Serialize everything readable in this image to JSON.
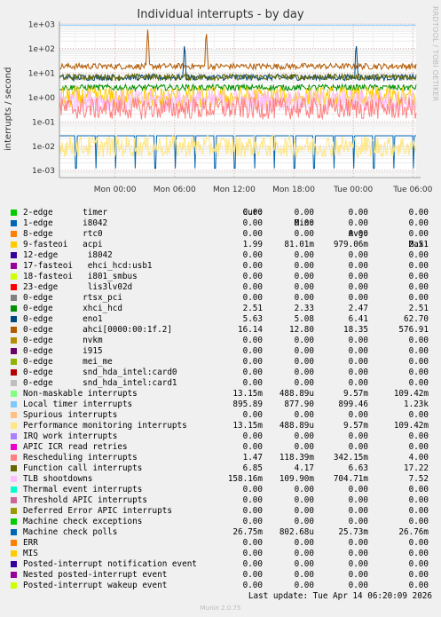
{
  "title": "Individual interrupts - by day",
  "side_label": "RRDTOOL / TOBI OETIKER",
  "ylabel": "interrupts / second",
  "headers": {
    "cur": "Cur:",
    "min": "Min:",
    "avg": "Avg:",
    "max": "Max:"
  },
  "legend": [
    {
      "name": "2-edge      timer",
      "color": "#00cc00",
      "cur": "0.00",
      "min": "0.00",
      "avg": "0.00",
      "max": "0.00"
    },
    {
      "name": "1-edge      i8042",
      "color": "#0066b3",
      "cur": "0.00",
      "min": "0.00",
      "avg": "0.00",
      "max": "0.00"
    },
    {
      "name": "8-edge      rtc0",
      "color": "#ff8000",
      "cur": "0.00",
      "min": "0.00",
      "avg": "0.00",
      "max": "0.00"
    },
    {
      "name": "9-fasteoi   acpi",
      "color": "#ffcc00",
      "cur": "1.99",
      "min": "81.01m",
      "avg": "979.06m",
      "max": "2.51"
    },
    {
      "name": "12-edge      i8042",
      "color": "#330099",
      "cur": "0.00",
      "min": "0.00",
      "avg": "0.00",
      "max": "0.00"
    },
    {
      "name": "17-fasteoi   ehci_hcd:usb1",
      "color": "#990099",
      "cur": "0.00",
      "min": "0.00",
      "avg": "0.00",
      "max": "0.00"
    },
    {
      "name": "18-fasteoi   i801_smbus",
      "color": "#ccff00",
      "cur": "0.00",
      "min": "0.00",
      "avg": "0.00",
      "max": "0.00"
    },
    {
      "name": "23-edge      lis3lv02d",
      "color": "#ff0000",
      "cur": "0.00",
      "min": "0.00",
      "avg": "0.00",
      "max": "0.00"
    },
    {
      "name": "0-edge      rtsx_pci",
      "color": "#808080",
      "cur": "0.00",
      "min": "0.00",
      "avg": "0.00",
      "max": "0.00"
    },
    {
      "name": "0-edge      xhci_hcd",
      "color": "#008f00",
      "cur": "2.51",
      "min": "2.33",
      "avg": "2.47",
      "max": "2.51"
    },
    {
      "name": "0-edge      eno1",
      "color": "#00487d",
      "cur": "5.63",
      "min": "5.08",
      "avg": "6.41",
      "max": "62.70"
    },
    {
      "name": "0-edge      ahci[0000:00:1f.2]",
      "color": "#b35a00",
      "cur": "16.14",
      "min": "12.80",
      "avg": "18.35",
      "max": "576.91"
    },
    {
      "name": "0-edge      nvkm",
      "color": "#b38f00",
      "cur": "0.00",
      "min": "0.00",
      "avg": "0.00",
      "max": "0.00"
    },
    {
      "name": "0-edge      i915",
      "color": "#6b006b",
      "cur": "0.00",
      "min": "0.00",
      "avg": "0.00",
      "max": "0.00"
    },
    {
      "name": "0-edge      mei_me",
      "color": "#8fb300",
      "cur": "0.00",
      "min": "0.00",
      "avg": "0.00",
      "max": "0.00"
    },
    {
      "name": "0-edge      snd_hda_intel:card0",
      "color": "#b30000",
      "cur": "0.00",
      "min": "0.00",
      "avg": "0.00",
      "max": "0.00"
    },
    {
      "name": "0-edge      snd_hda_intel:card1",
      "color": "#bebebe",
      "cur": "0.00",
      "min": "0.00",
      "avg": "0.00",
      "max": "0.00"
    },
    {
      "name": "Non-maskable interrupts",
      "color": "#80ff80",
      "cur": "13.15m",
      "min": "488.89u",
      "avg": "9.57m",
      "max": "109.42m"
    },
    {
      "name": "Local timer interrupts",
      "color": "#80c9ff",
      "cur": "895.89",
      "min": "877.90",
      "avg": "899.46",
      "max": "1.23k"
    },
    {
      "name": "Spurious interrupts",
      "color": "#ffc080",
      "cur": "0.00",
      "min": "0.00",
      "avg": "0.00",
      "max": "0.00"
    },
    {
      "name": "Performance monitoring interrupts",
      "color": "#ffe680",
      "cur": "13.15m",
      "min": "488.89u",
      "avg": "9.57m",
      "max": "109.42m"
    },
    {
      "name": "IRQ work interrupts",
      "color": "#aa80ff",
      "cur": "0.00",
      "min": "0.00",
      "avg": "0.00",
      "max": "0.00"
    },
    {
      "name": "APIC ICR read retries",
      "color": "#ee00cc",
      "cur": "0.00",
      "min": "0.00",
      "avg": "0.00",
      "max": "0.00"
    },
    {
      "name": "Rescheduling interrupts",
      "color": "#ff8080",
      "cur": "1.47",
      "min": "118.39m",
      "avg": "342.15m",
      "max": "4.00"
    },
    {
      "name": "Function call interrupts",
      "color": "#666600",
      "cur": "6.85",
      "min": "4.17",
      "avg": "6.63",
      "max": "17.22"
    },
    {
      "name": "TLB shootdowns",
      "color": "#ffbfff",
      "cur": "158.16m",
      "min": "109.90m",
      "avg": "704.71m",
      "max": "7.52"
    },
    {
      "name": "Thermal event interrupts",
      "color": "#00ffcc",
      "cur": "0.00",
      "min": "0.00",
      "avg": "0.00",
      "max": "0.00"
    },
    {
      "name": "Threshold APIC interrupts",
      "color": "#cc6699",
      "cur": "0.00",
      "min": "0.00",
      "avg": "0.00",
      "max": "0.00"
    },
    {
      "name": "Deferred Error APIC interrupts",
      "color": "#999900",
      "cur": "0.00",
      "min": "0.00",
      "avg": "0.00",
      "max": "0.00"
    },
    {
      "name": "Machine check exceptions",
      "color": "#00cc00",
      "cur": "0.00",
      "min": "0.00",
      "avg": "0.00",
      "max": "0.00"
    },
    {
      "name": "Machine check polls",
      "color": "#0066b3",
      "cur": "26.75m",
      "min": "802.68u",
      "avg": "25.73m",
      "max": "26.76m"
    },
    {
      "name": "ERR",
      "color": "#ff8000",
      "cur": "0.00",
      "min": "0.00",
      "avg": "0.00",
      "max": "0.00"
    },
    {
      "name": "MIS",
      "color": "#ffcc00",
      "cur": "0.00",
      "min": "0.00",
      "avg": "0.00",
      "max": "0.00"
    },
    {
      "name": "Posted-interrupt notification event",
      "color": "#330099",
      "cur": "0.00",
      "min": "0.00",
      "avg": "0.00",
      "max": "0.00"
    },
    {
      "name": "Nested posted-interrupt event",
      "color": "#990099",
      "cur": "0.00",
      "min": "0.00",
      "avg": "0.00",
      "max": "0.00"
    },
    {
      "name": "Posted-interrupt wakeup event",
      "color": "#ccff00",
      "cur": "0.00",
      "min": "0.00",
      "avg": "0.00",
      "max": "0.00"
    }
  ],
  "last_update": "Last update: Tue Apr 14 06:20:09 2026",
  "munin": "Munin 2.0.75",
  "chart_data": {
    "type": "line",
    "title": "Individual interrupts - by day",
    "ylabel": "interrupts / second",
    "yscale": "log",
    "ylim": [
      0.0005,
      1000
    ],
    "y_ticks": [
      "1e-03",
      "1e-02",
      "1e-01",
      "1e+00",
      "1e+01",
      "1e+02",
      "1e+03"
    ],
    "x_ticks": [
      "Mon 00:00",
      "Mon 06:00",
      "Mon 12:00",
      "Mon 18:00",
      "Tue 00:00",
      "Tue 06:00"
    ],
    "x_range_hours": [
      -5.6,
      30.33
    ],
    "series": [
      {
        "name": "Local timer interrupts",
        "color": "#80c9ff",
        "level": 899
      },
      {
        "name": "0-edge      ahci[0000:00:1f.2]",
        "color": "#b35a00",
        "level": 18.35,
        "spikes_hours": [
          3.3,
          9.2
        ]
      },
      {
        "name": "0-edge      eno1",
        "color": "#00487d",
        "level": 6.41,
        "spikes_hours": [
          7.0,
          24.3
        ]
      },
      {
        "name": "Function call interrupts",
        "color": "#666600",
        "level": 6.63
      },
      {
        "name": "0-edge      xhci_hcd",
        "color": "#008f00",
        "level": 2.47
      },
      {
        "name": "9-fasteoi   acpi",
        "color": "#ffcc00",
        "level": 0.979
      },
      {
        "name": "TLB shootdowns",
        "color": "#ffbfff",
        "level": 0.705
      },
      {
        "name": "Rescheduling interrupts",
        "color": "#ff8080",
        "level": 0.342
      },
      {
        "name": "Machine check polls",
        "color": "#0066b3",
        "level": 0.0257,
        "dips_every_hours": 2.0
      },
      {
        "name": "Performance monitoring interrupts",
        "color": "#ffe680",
        "level": 0.0096
      }
    ]
  }
}
